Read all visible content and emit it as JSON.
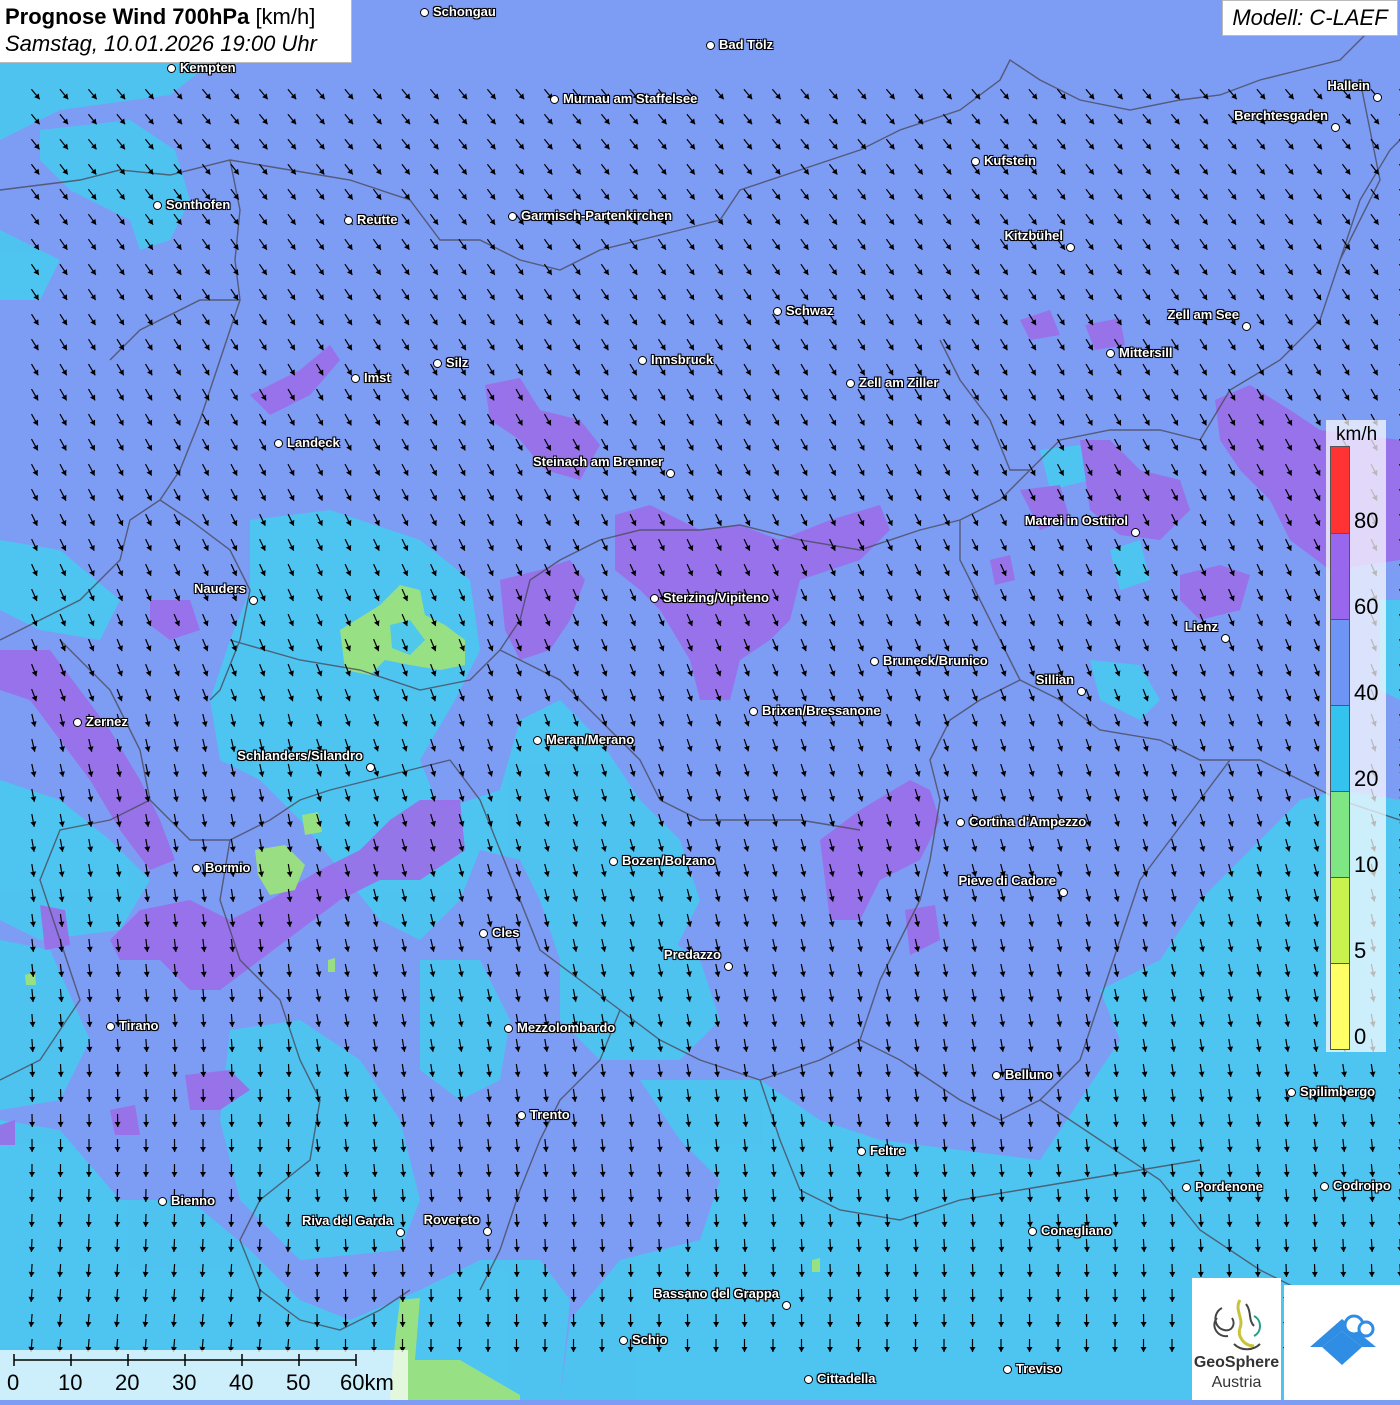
{
  "title": {
    "main": "Prognose Wind 700hPa",
    "unit": "[km/h]",
    "datetime": "Samstag, 10.01.2026 19:00 Uhr"
  },
  "model": "Modell: C-LAEF",
  "legend": {
    "unit": "km/h",
    "ticks": [
      "80",
      "60",
      "40",
      "20",
      "10",
      "5",
      "0"
    ],
    "colors": [
      "#ff3333",
      "#9966ee",
      "#6e95f5",
      "#33c3ee",
      "#7ee682",
      "#c8f24e",
      "#ffff66"
    ]
  },
  "scale": {
    "labels": [
      "0",
      "10",
      "20",
      "30",
      "40",
      "50",
      "60km"
    ]
  },
  "logo": {
    "line1": "GeoSphere",
    "line2": "Austria"
  },
  "colors": {
    "base_blue": "#7d9cf4",
    "cyan": "#4cc6f0",
    "purple": "#9a6fe8",
    "green": "#9be27c",
    "border": "#4a4a5a",
    "arrow": "#000000",
    "brand_blue": "#2f8de4"
  },
  "wind": {
    "direction": "NW to SE",
    "range_kmh": "10–80"
  },
  "cities": [
    {
      "name": "Schongau"
    },
    {
      "name": "Kempten"
    },
    {
      "name": "Bad Tölz"
    },
    {
      "name": "Murnau am Staffelsee"
    },
    {
      "name": "Hallein"
    },
    {
      "name": "Berchtesgaden"
    },
    {
      "name": "Kufstein"
    },
    {
      "name": "Sonthofen"
    },
    {
      "name": "Reutte"
    },
    {
      "name": "Garmisch-Partenkirchen"
    },
    {
      "name": "Kitzbühel"
    },
    {
      "name": "Schwaz"
    },
    {
      "name": "Zell am See"
    },
    {
      "name": "Mittersill"
    },
    {
      "name": "Silz"
    },
    {
      "name": "Innsbruck"
    },
    {
      "name": "Imst"
    },
    {
      "name": "Zell am Ziller"
    },
    {
      "name": "Landeck"
    },
    {
      "name": "Steinach am Brenner"
    },
    {
      "name": "Matrei in Osttirol"
    },
    {
      "name": "Nauders"
    },
    {
      "name": "Sterzing/Vipiteno"
    },
    {
      "name": "Lienz"
    },
    {
      "name": "Bruneck/Brunico"
    },
    {
      "name": "Sillian"
    },
    {
      "name": "Brixen/Bressanone"
    },
    {
      "name": "Zernez"
    },
    {
      "name": "Meran/Merano"
    },
    {
      "name": "Schlanders/Silandro"
    },
    {
      "name": "Cortina d'Ampezzo"
    },
    {
      "name": "Bozen/Bolzano"
    },
    {
      "name": "Bormio"
    },
    {
      "name": "Pieve di Cadore"
    },
    {
      "name": "Cles"
    },
    {
      "name": "Predazzo"
    },
    {
      "name": "Tirano"
    },
    {
      "name": "Mezzolombardo"
    },
    {
      "name": "Belluno"
    },
    {
      "name": "Spilimbergo"
    },
    {
      "name": "Trento"
    },
    {
      "name": "Feltre"
    },
    {
      "name": "Pordenone"
    },
    {
      "name": "Codroipo"
    },
    {
      "name": "Bienno"
    },
    {
      "name": "Riva del Garda"
    },
    {
      "name": "Rovereto"
    },
    {
      "name": "Conegliano"
    },
    {
      "name": "Bassano del Grappa"
    },
    {
      "name": "Schio"
    },
    {
      "name": "Treviso"
    },
    {
      "name": "Cittadella"
    }
  ]
}
